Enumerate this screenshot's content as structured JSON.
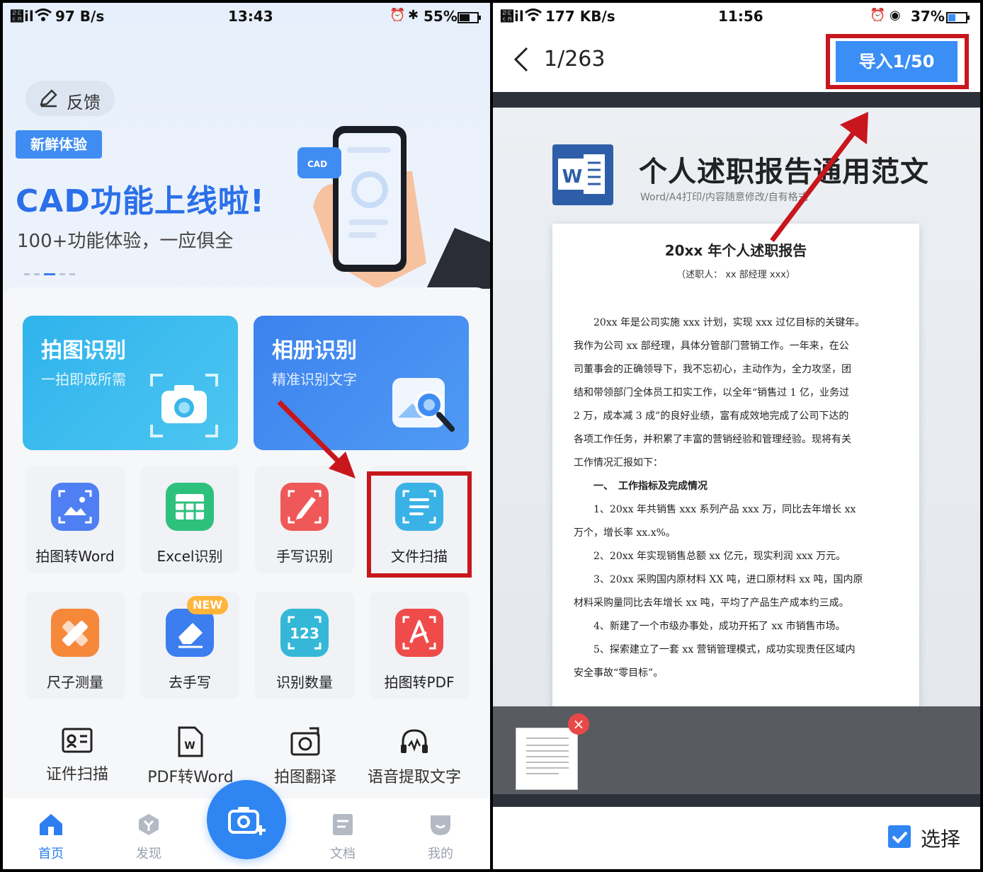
{
  "left": {
    "status": {
      "signal": "⹪il",
      "net": "97 B/s",
      "time": "13:43",
      "battery": "55%"
    },
    "feedback_label": "反馈",
    "promo": {
      "badge": "新鲜体验",
      "title": "CAD功能上线啦!",
      "subtitle": "100+功能体验，一应俱全",
      "art_label": "CAD"
    },
    "big_cards": [
      {
        "title": "拍图识别",
        "subtitle": "一拍即成所需"
      },
      {
        "title": "相册识别",
        "subtitle": "精准识别文字"
      }
    ],
    "tools": [
      {
        "label": "拍图转Word",
        "icon": "photo-to-word-icon",
        "color": "#4f7ff2"
      },
      {
        "label": "Excel识别",
        "icon": "excel-icon",
        "color": "#2ec07d"
      },
      {
        "label": "手写识别",
        "icon": "handwriting-icon",
        "color": "#ef5858"
      },
      {
        "label": "文件扫描",
        "icon": "file-scan-icon",
        "color": "#3bb2e6"
      },
      {
        "label": "尺子测量",
        "icon": "ruler-icon",
        "color": "#f6883a"
      },
      {
        "label": "去手写",
        "icon": "eraser-icon",
        "color": "#3c7def",
        "badge": "NEW"
      },
      {
        "label": "识别数量",
        "icon": "count-icon",
        "color": "#35b8d8"
      },
      {
        "label": "拍图转PDF",
        "icon": "photo-to-pdf-icon",
        "color": "#ef4b4b"
      }
    ],
    "mini_tools": [
      {
        "label": "证件扫描",
        "icon": "id-card-icon"
      },
      {
        "label": "PDF转Word",
        "icon": "pdf-to-word-icon"
      },
      {
        "label": "拍图翻译",
        "icon": "photo-translate-icon"
      },
      {
        "label": "语音提取文字",
        "icon": "voice-extract-icon"
      }
    ],
    "tabs": [
      {
        "label": "首页",
        "icon": "home-icon"
      },
      {
        "label": "发现",
        "icon": "discover-icon"
      },
      {
        "label": "文档",
        "icon": "documents-icon"
      },
      {
        "label": "我的",
        "icon": "profile-icon"
      }
    ],
    "accent": "#2f86f3",
    "highlight_color": "#c8161d"
  },
  "right": {
    "status": {
      "signal": "⹪il",
      "net": "177 KB/s",
      "time": "11:56",
      "battery": "37%"
    },
    "page_counter": "1/263",
    "import_label": "导入1/50",
    "doc_title": "个人述职报告通用范文",
    "doc_caption": "Word/A4打印/内容随意修改/自有格式",
    "paper_title": "20xx 年个人述职报告",
    "paper_subtitle": "（述职人： xx 部经理 xxx）",
    "paper_lines": [
      "　　20xx 年是公司实施 xxx 计划，实现 xxx 过亿目标的关键年。",
      "我作为公司 xx 部经理，具体分管部门营销工作。一年来，在公",
      "司董事会的正确领导下，我不忘初心，主动作为，全力攻坚，团",
      "结和带领部门全体员工扣实工作，以全年“销售过 1 亿，业务过",
      "2 万，成本减 3 成”的良好业绩，富有成效地完成了公司下达的",
      "各项工作任务，并积累了丰富的营销经验和管理经验。现将有关",
      "工作情况汇报如下：",
      "　　一、　工作指标及完成情况",
      "　　1、20xx 年共销售 xxx 系列产品 xxx 万，同比去年增长 xx",
      "万个，增长率 xx.x%。",
      "　　2、20xx 年实现销售总额 xx 亿元，现实利润 xxx 万元。",
      "　　3、20xx 采购国内原材料 XX 吨，进口原材料 xx 吨，国内原",
      "材料采购量同比去年增长 xx 吨，平均了产品生产成本约三成。",
      "　　4、新建了一个市级办事处，成功开拓了 xx 市销售市场。",
      "　　5、探索建立了一套 xx 营销管理模式，成功实现责任区域内",
      "安全事故“零目标”。"
    ],
    "select_label": "选择",
    "select_checked": true
  }
}
